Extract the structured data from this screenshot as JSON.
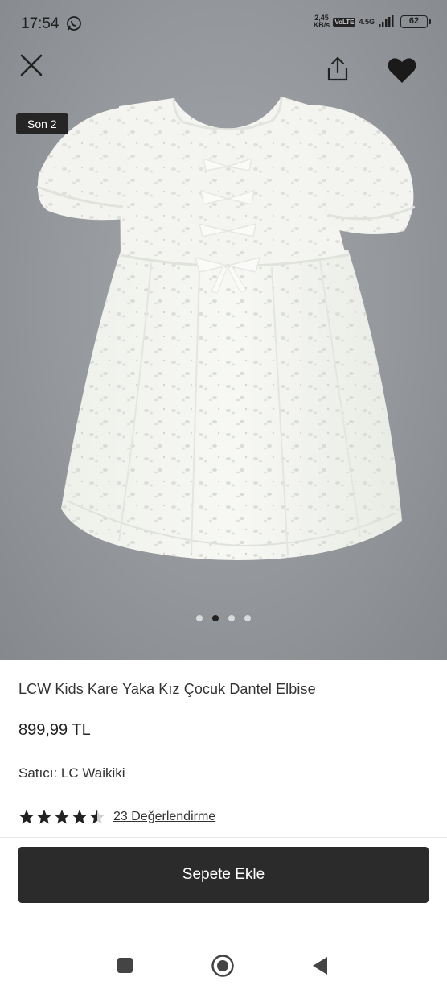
{
  "status_bar": {
    "time": "17:54",
    "net_speed_value": "2,45",
    "net_speed_unit": "KB/s",
    "volte": "VoLTE",
    "network": "4.5G",
    "battery": "62"
  },
  "gallery": {
    "badge": "Son 2",
    "image_count": 4,
    "active_index": 1
  },
  "product": {
    "title": "LCW Kids Kare Yaka Kız Çocuk Dantel Elbise",
    "price": "899,99 TL",
    "seller": "Satıcı: LC Waikiki",
    "rating": 4.5,
    "reviews_label": "23 Değerlendirme"
  },
  "actions": {
    "add_to_cart": "Sepete Ekle"
  },
  "icons": {
    "close": "close-icon",
    "share": "share-icon",
    "favorite": "heart-icon",
    "whatsapp": "whatsapp-icon"
  },
  "colors": {
    "button_bg": "#2b2b2b",
    "image_bg": "#8f9296",
    "active_dot": "#222222"
  }
}
